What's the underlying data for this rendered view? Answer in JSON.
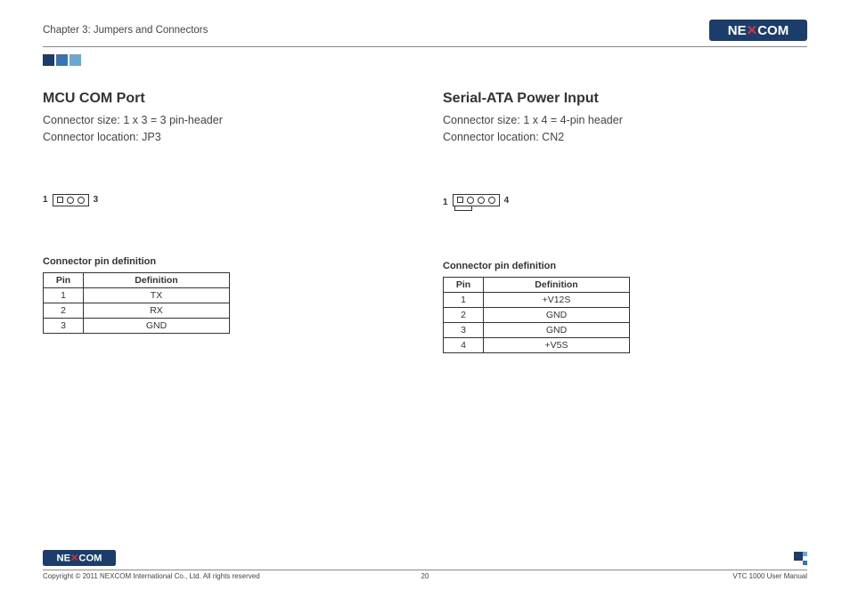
{
  "header": {
    "chapter": "Chapter 3: Jumpers and Connectors",
    "brand": "NEXCOM"
  },
  "left": {
    "title": "MCU COM Port",
    "size_label": "Connector size: 1 x 3 = 3 pin-header",
    "location_label": "Connector location: JP3",
    "diagram_start": "1",
    "diagram_end": "3",
    "table_title": "Connector pin definition",
    "headers": {
      "pin": "Pin",
      "def": "Definition"
    },
    "rows": [
      {
        "pin": "1",
        "def": "TX"
      },
      {
        "pin": "2",
        "def": "RX"
      },
      {
        "pin": "3",
        "def": "GND"
      }
    ]
  },
  "right": {
    "title": "Serial-ATA Power Input",
    "size_label": "Connector size: 1 x 4 = 4-pin header",
    "location_label": "Connector location: CN2",
    "diagram_start": "1",
    "diagram_end": "4",
    "table_title": "Connector pin definition",
    "headers": {
      "pin": "Pin",
      "def": "Definition"
    },
    "rows": [
      {
        "pin": "1",
        "def": "+V12S"
      },
      {
        "pin": "2",
        "def": "GND"
      },
      {
        "pin": "3",
        "def": "GND"
      },
      {
        "pin": "4",
        "def": "+V5S"
      }
    ]
  },
  "footer": {
    "copyright": "Copyright © 2011 NEXCOM International Co., Ltd. All rights reserved",
    "page": "20",
    "manual": "VTC 1000 User Manual"
  }
}
